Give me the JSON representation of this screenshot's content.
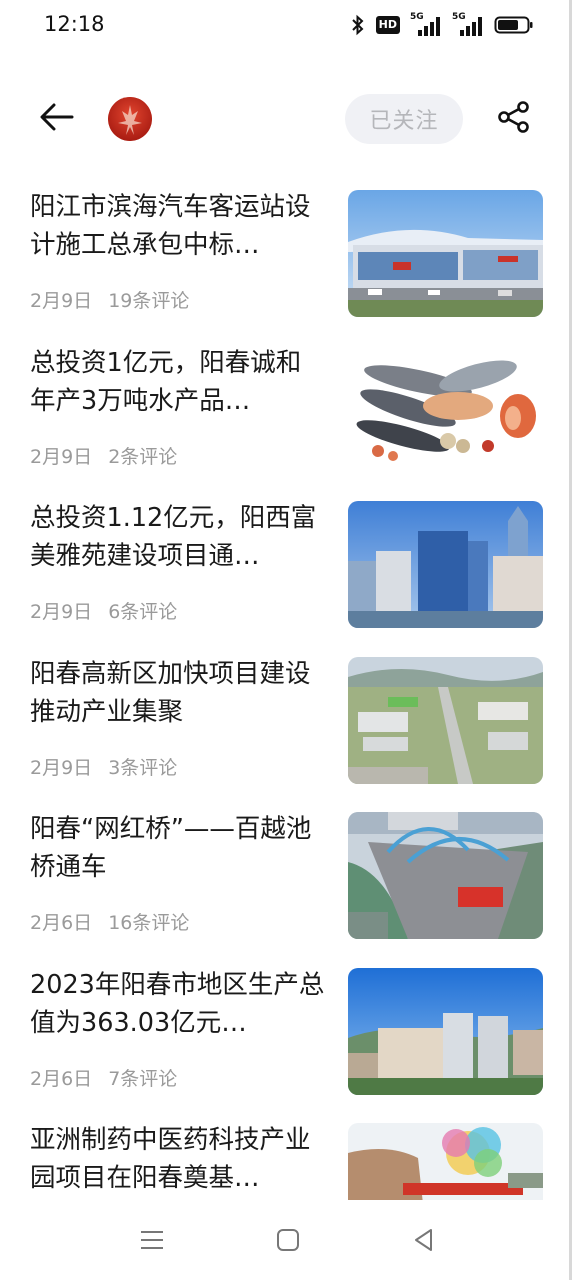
{
  "status_bar": {
    "time": "12:18",
    "icons": [
      "bluetooth-icon",
      "hd-icon",
      "signal-5g-icon",
      "signal-5g-icon",
      "battery-icon"
    ],
    "hd_label": "HD",
    "signal_label_1": "5G",
    "signal_label_2": "5G"
  },
  "header": {
    "back_icon": "arrow-left-icon",
    "follow_label": "已关注",
    "share_icon": "share-icon"
  },
  "articles": [
    {
      "title": "阳江市滨海汽车客运站设计施工总承包中标…",
      "date": "2月9日",
      "comments": "19条评论",
      "thumb": "bus-station"
    },
    {
      "title": "总投资1亿元，阳春诚和年产3万吨水产品…",
      "date": "2月9日",
      "comments": "2条评论",
      "thumb": "seafood"
    },
    {
      "title": "总投资1.12亿元，阳西富美雅苑建设项目通…",
      "date": "2月9日",
      "comments": "6条评论",
      "thumb": "towers"
    },
    {
      "title": "阳春高新区加快项目建设推动产业集聚",
      "date": "2月9日",
      "comments": "3条评论",
      "thumb": "industrial-park"
    },
    {
      "title": "阳春“网红桥”——百越池桥通车",
      "date": "2月6日",
      "comments": "16条评论",
      "thumb": "bridge"
    },
    {
      "title": "2023年阳春市地区生产总值为363.03亿元…",
      "date": "2月6日",
      "comments": "7条评论",
      "thumb": "city"
    },
    {
      "title": "亚洲制药中医药科技产业园项目在阳春奠基…",
      "date": "",
      "comments": "",
      "thumb": "ceremony"
    }
  ],
  "nav_bar": {
    "icons": [
      "menu-icon",
      "home-square-icon",
      "back-triangle-icon"
    ]
  },
  "colors": {
    "follow_bg": "#f0f1f5",
    "follow_text": "#b5b6ba",
    "meta_text": "#9a9a9a",
    "avatar_red": "#c0281b"
  }
}
